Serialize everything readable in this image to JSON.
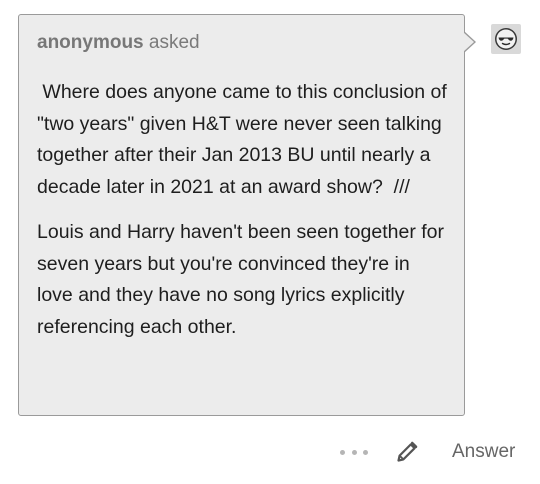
{
  "ask": {
    "asker_name": "anonymous",
    "asked_label": "asked",
    "question": " Where does anyone came to this conclusion of \"two years\" given H&T were never seen talking together after their Jan 2013 BU until nearly a decade later in 2021 at an award show?  ///",
    "answer": "Louis and Harry haven't been seen together for seven years but you're convinced they're in love and they have no song lyrics explicitly referencing each other."
  },
  "avatar": {
    "icon": "sunglasses-face-icon"
  },
  "footer": {
    "more_icon": "ellipsis-icon",
    "edit_icon": "pencil-icon",
    "answer_label": "Answer"
  },
  "colors": {
    "box_background": "#ececec",
    "box_border": "#9a9a9a",
    "muted_text": "#777777",
    "body_text": "#1e1e1e"
  }
}
